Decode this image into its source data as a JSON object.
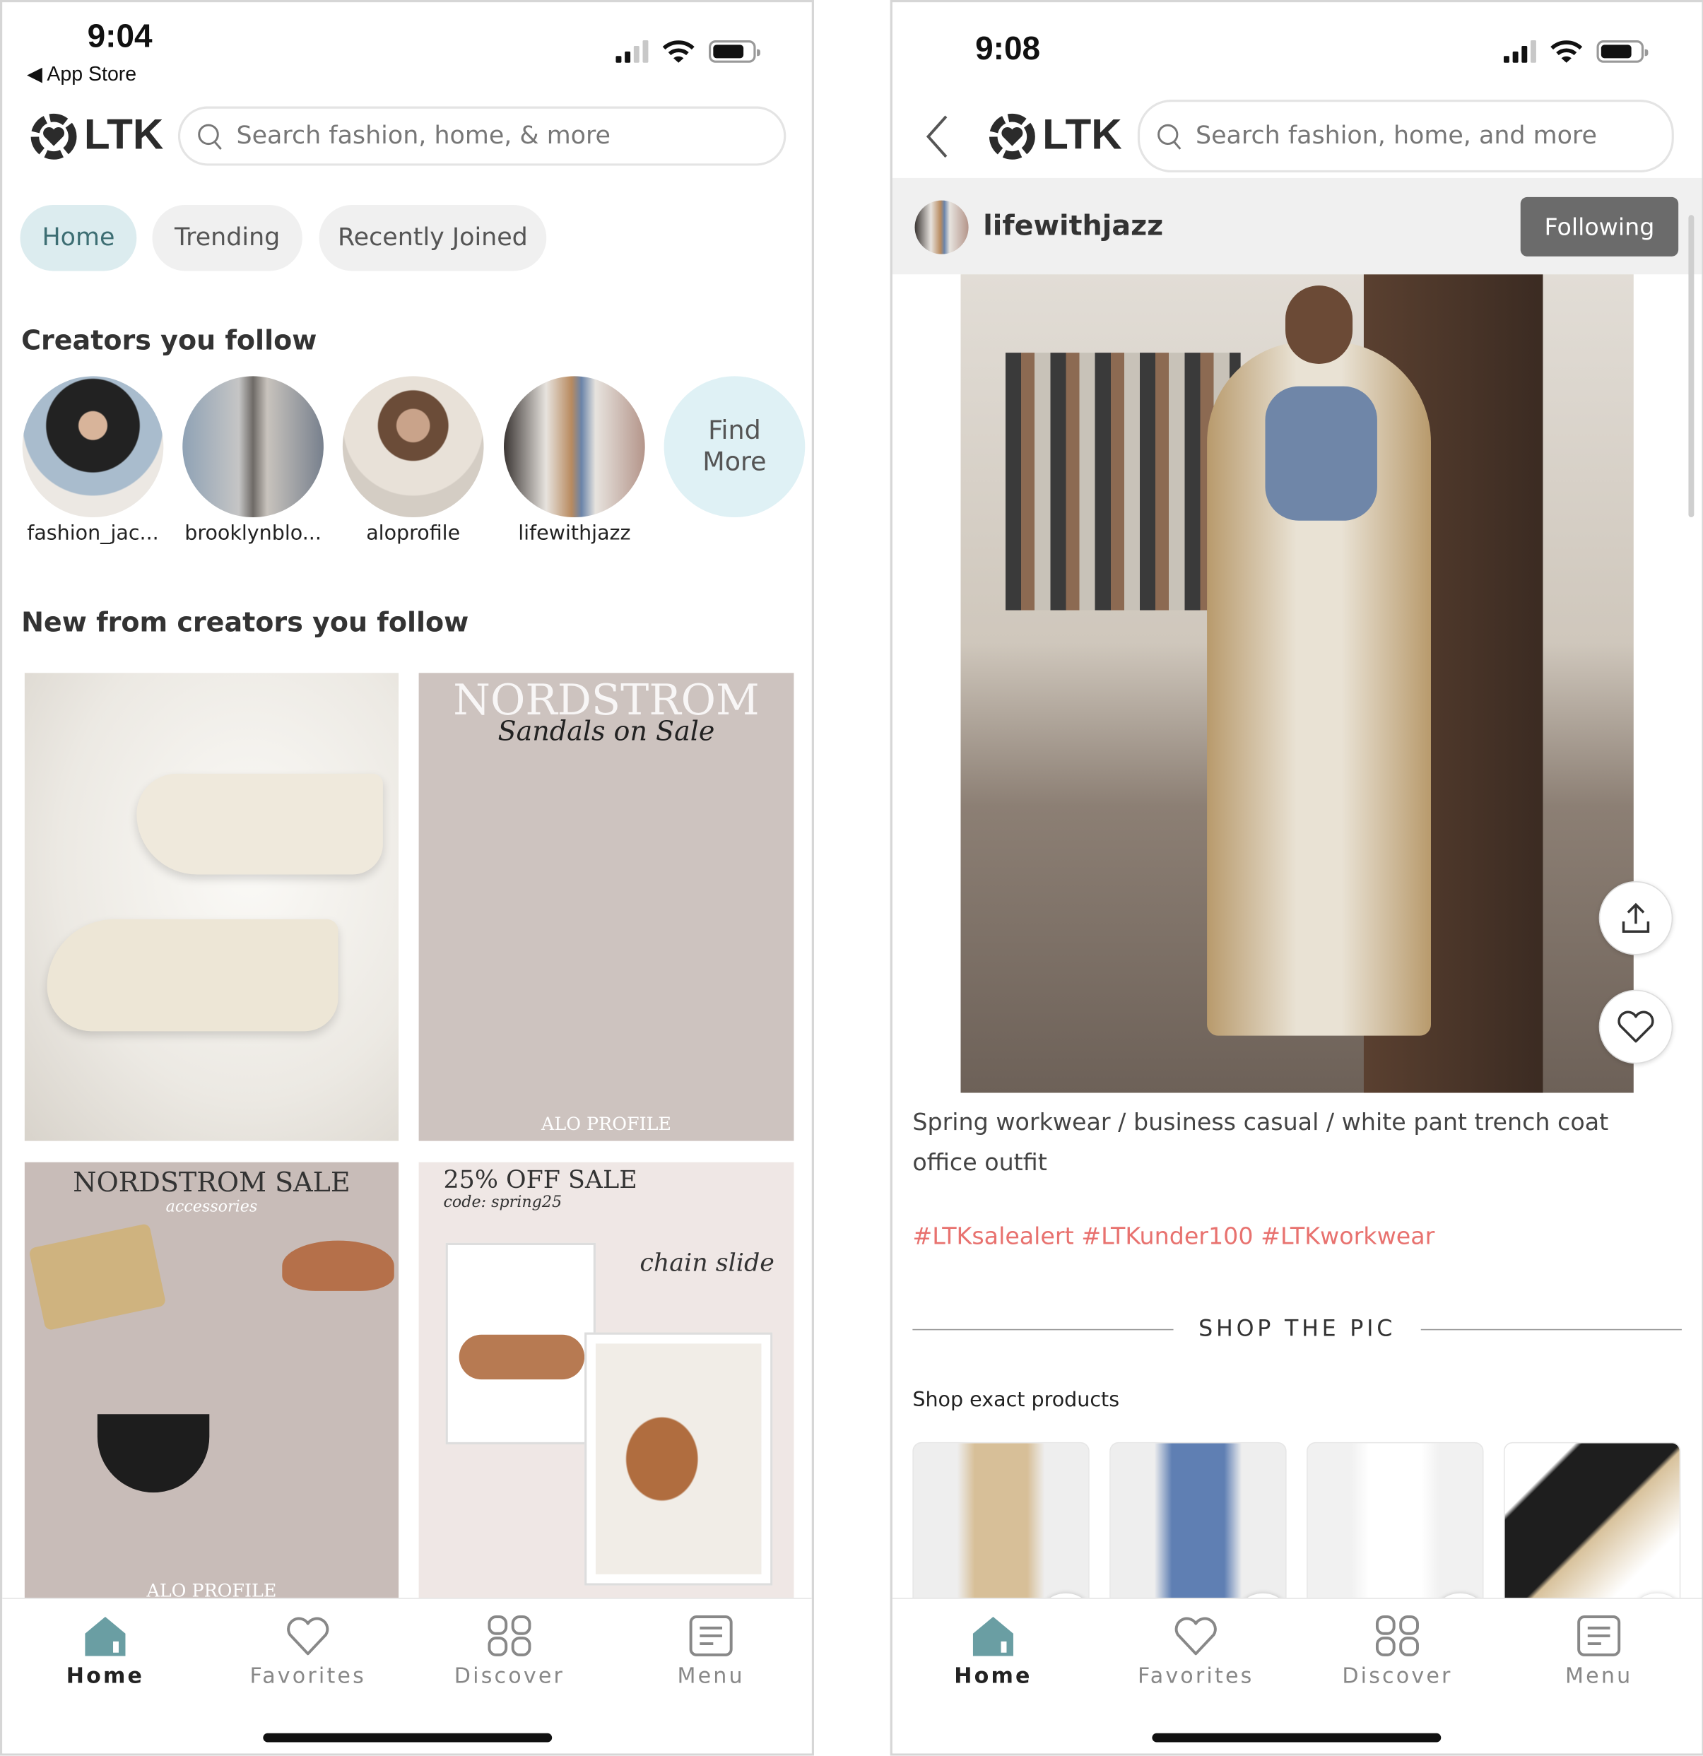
{
  "left": {
    "status": {
      "time": "9:04",
      "back_label": "App Store"
    },
    "header": {
      "logo_text": "LTK",
      "search_placeholder": "Search fashion, home, & more"
    },
    "tabs": [
      {
        "label": "Home",
        "active": true
      },
      {
        "label": "Trending",
        "active": false
      },
      {
        "label": "Recently Joined",
        "active": false
      }
    ],
    "creators_title": "Creators you follow",
    "creators": [
      {
        "name": "fashion_jac..."
      },
      {
        "name": "brooklynblo..."
      },
      {
        "name": "aloprofile"
      },
      {
        "name": "lifewithjazz"
      }
    ],
    "find_more": {
      "line1": "Find",
      "line2": "More"
    },
    "feed_title": "New from creators you follow",
    "posts": [
      {
        "title": "",
        "subtitle": ""
      },
      {
        "title": "NORDSTROM",
        "subtitle": "Sandals on Sale",
        "footer": "ALO PROFILE"
      },
      {
        "title": "NORDSTROM SALE",
        "subtitle": "accessories",
        "footer": "ALO PROFILE"
      },
      {
        "title": "25% OFF SALE",
        "subtitle": "code: spring25",
        "tag": "chain slide"
      }
    ]
  },
  "right": {
    "status": {
      "time": "9:08"
    },
    "header": {
      "logo_text": "LTK",
      "search_placeholder": "Search fashion, home, and more"
    },
    "creator": {
      "name": "lifewithjazz",
      "follow_label": "Following"
    },
    "caption": "Spring workwear / business casual / white pant trench coat office outfit",
    "hashtags": "#LTKsalealert #LTKunder100 #LTKworkwear",
    "shop_title": "SHOP THE PIC",
    "shop_subtitle": "Shop exact products",
    "products": [
      {
        "icon": "trench-coat"
      },
      {
        "icon": "blue-blouse"
      },
      {
        "icon": "white-pants"
      },
      {
        "icon": "black-pumps"
      }
    ]
  },
  "nav": [
    {
      "label": "Home",
      "icon": "home-icon",
      "active": true
    },
    {
      "label": "Favorites",
      "icon": "heart-icon"
    },
    {
      "label": "Discover",
      "icon": "grid-icon"
    },
    {
      "label": "Menu",
      "icon": "menu-icon"
    }
  ],
  "colors": {
    "accent": "#6a9ea3",
    "tab_active_bg": "#dcecef",
    "hashtag": "#e8726f",
    "following_bg": "#6b6b6b"
  }
}
